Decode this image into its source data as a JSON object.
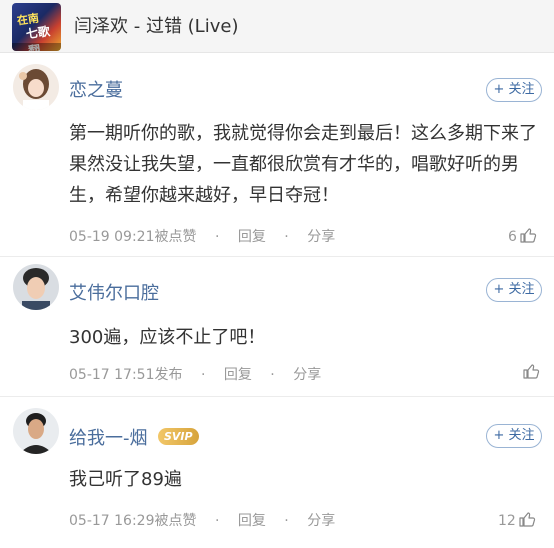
{
  "song": {
    "title": "闫泽欢 - 过错 (Live)",
    "cover_text_1": "在南",
    "cover_text_2": "七歌翻"
  },
  "follow_label": "+ 关注",
  "comments": [
    {
      "username": "恋之蔓",
      "text": "第一期听你的歌，我就觉得你会走到最后！这么多期下来了果然没让我失望，一直都很欣赏有才华的，唱歌好听的男生，希望你越来越好，早日夺冠！",
      "time": "05-19 09:21",
      "action": "被点赞",
      "reply": "回复",
      "share": "分享",
      "likes": "6"
    },
    {
      "username": "艾伟尔口腔",
      "text": "300遍，应该不止了吧！",
      "time": "05-17 17:51",
      "action": "发布",
      "reply": "回复",
      "share": "分享",
      "likes": ""
    },
    {
      "username": "给我一-烟",
      "badge": "SVIP",
      "text": "我己听了89遍",
      "time": "05-17 16:29",
      "action": "被点赞",
      "reply": "回复",
      "share": "分享",
      "likes": "12"
    }
  ],
  "separator": "·"
}
